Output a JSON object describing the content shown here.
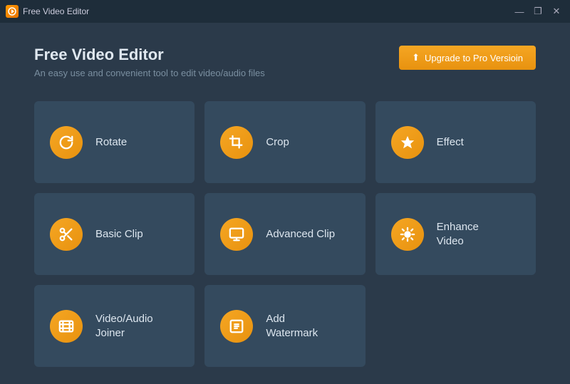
{
  "titlebar": {
    "title": "Free Video Editor",
    "controls": {
      "minimize": "—",
      "maximize": "❐",
      "close": "✕"
    }
  },
  "header": {
    "app_title": "Free Video Editor",
    "app_subtitle": "An easy use and convenient tool to edit video/audio files",
    "upgrade_button": "Upgrade to Pro Versioin"
  },
  "tools": [
    {
      "id": "rotate",
      "label": "Rotate",
      "icon": "↻"
    },
    {
      "id": "crop",
      "label": "Crop",
      "icon": "⊡"
    },
    {
      "id": "effect",
      "label": "Effect",
      "icon": "★"
    },
    {
      "id": "basic-clip",
      "label": "Basic Clip",
      "icon": "✂"
    },
    {
      "id": "advanced-clip",
      "label": "Advanced Clip",
      "icon": "⊞"
    },
    {
      "id": "enhance-video",
      "label": "Enhance\nVideo",
      "icon": "🎨"
    },
    {
      "id": "video-audio-joiner",
      "label": "Video/Audio\nJoiner",
      "icon": "▣"
    },
    {
      "id": "add-watermark",
      "label": "Add\nWatermark",
      "icon": "⊟"
    }
  ],
  "colors": {
    "accent": "#f5a623",
    "bg": "#2b3a4a",
    "card": "#344a5e",
    "titlebar": "#1e2d3a"
  }
}
